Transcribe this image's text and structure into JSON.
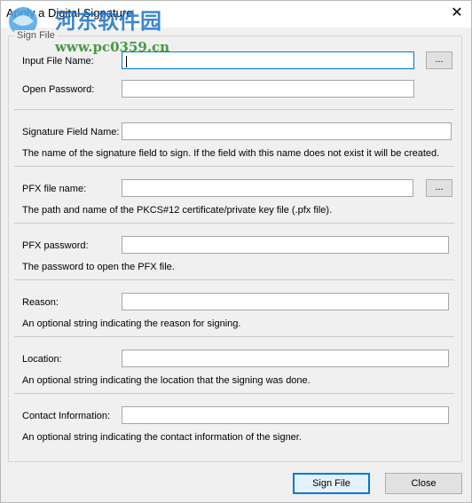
{
  "window": {
    "title": "Apply a Digital Signature"
  },
  "watermark": {
    "brand": "河东软件园",
    "url": "www.pc0359.cn"
  },
  "group": {
    "legend": "Sign File"
  },
  "fields": {
    "input_file": {
      "label": "Input File Name:",
      "value": "",
      "browse": "..."
    },
    "open_password": {
      "label": "Open Password:",
      "value": ""
    },
    "signature_field": {
      "label": "Signature Field Name:",
      "value": "",
      "description": "The name of the signature field to sign. If the field with this name does not exist it will be created."
    },
    "pfx_file": {
      "label": "PFX file name:",
      "value": "",
      "browse": "...",
      "description": "The path and name of the PKCS#12 certificate/private key file (.pfx file)."
    },
    "pfx_password": {
      "label": "PFX password:",
      "value": "",
      "description": "The password to open the PFX file."
    },
    "reason": {
      "label": "Reason:",
      "value": "",
      "description": "An optional string indicating the reason for signing."
    },
    "location": {
      "label": "Location:",
      "value": "",
      "description": "An optional string indicating the location that the signing was done."
    },
    "contact": {
      "label": "Contact Information:",
      "value": "",
      "description": "An optional string indicating the contact information of the signer."
    }
  },
  "buttons": {
    "sign": "Sign File",
    "close": "Close"
  },
  "colors": {
    "focus_border": "#0078d7",
    "watermark_blue": "#1a73c9",
    "watermark_green": "#2a8a2a"
  }
}
